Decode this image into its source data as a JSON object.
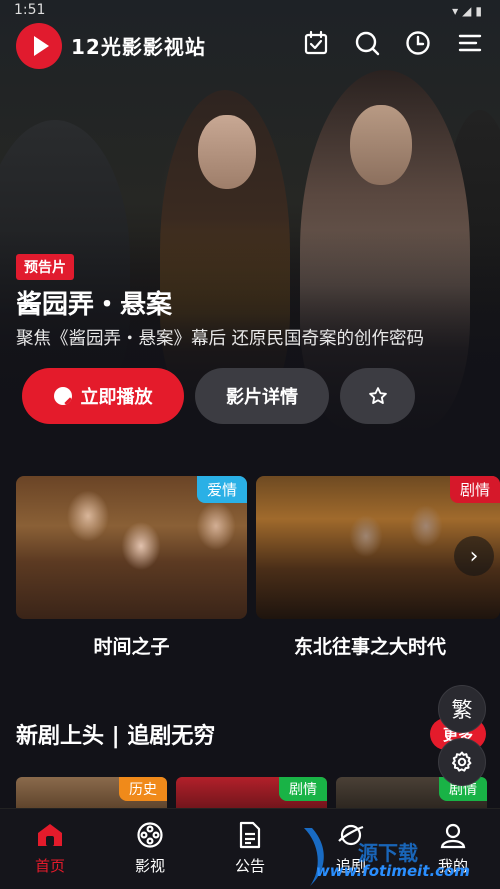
{
  "status": {
    "time": "1:51"
  },
  "header": {
    "site_name": "12光影影视站"
  },
  "hero": {
    "tag": "预告片",
    "title": "酱园弄・悬案",
    "subtitle": "聚焦《酱园弄・悬案》幕后 还原民国奇案的创作密码",
    "play_label": "立即播放",
    "detail_label": "影片详情"
  },
  "featured": [
    {
      "title": "时间之子",
      "genre": "爱情"
    },
    {
      "title": "东北往事之大时代",
      "genre": "剧情"
    }
  ],
  "new_section": {
    "title": "新剧上头 | 追剧无穷",
    "more_label": "更多",
    "traditional_label": "繁",
    "items": [
      {
        "genre": "历史"
      },
      {
        "genre": "剧情"
      },
      {
        "genre": "剧情"
      }
    ]
  },
  "nav": [
    {
      "label": "首页"
    },
    {
      "label": "影视"
    },
    {
      "label": "公告"
    },
    {
      "label": "追剧"
    },
    {
      "label": "我的"
    }
  ],
  "watermark": {
    "text": "www.fotimeit.com"
  },
  "colors": {
    "accent": "#e41b2b",
    "background": "#121218",
    "romance": "#2ab0e6",
    "history": "#f08a1a",
    "drama_green": "#19b346"
  }
}
